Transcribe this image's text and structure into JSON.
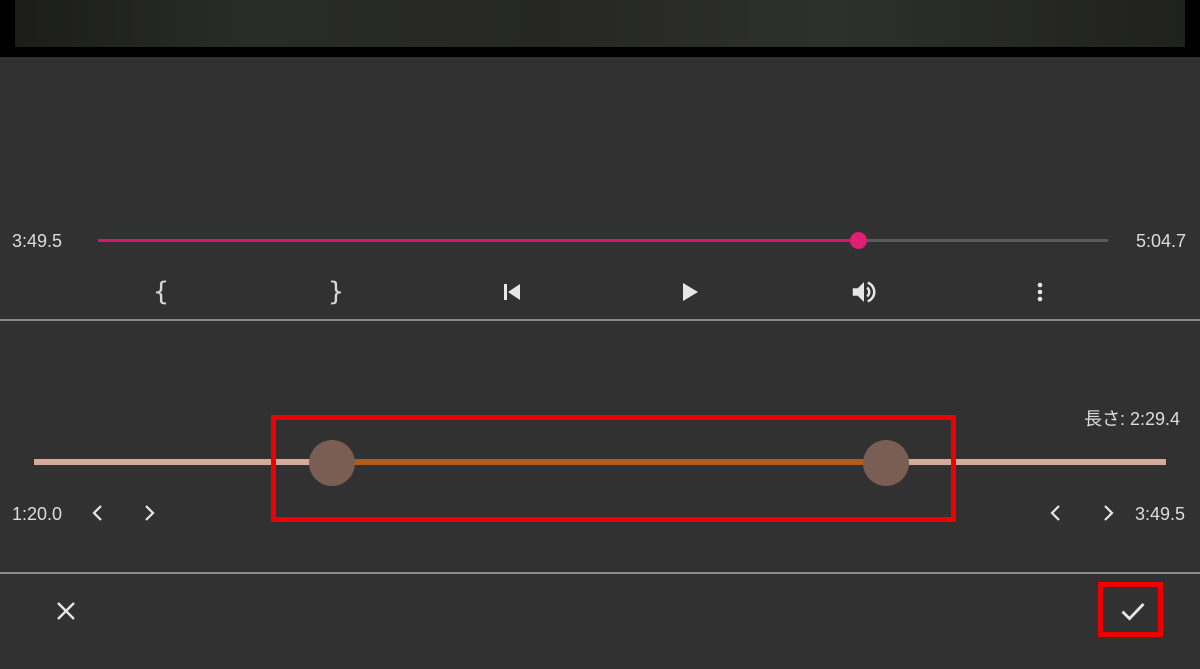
{
  "video": {
    "description_icon": "video-frame"
  },
  "player": {
    "current_time": "3:49.5",
    "total_time": "5:04.7",
    "progress_fraction": 0.752,
    "accent_color": "#d3196c",
    "controls": {
      "mark_in_label": "{",
      "mark_out_label": "}",
      "skip_previous_icon": "skip-previous-icon",
      "play_icon": "play-icon",
      "volume_icon": "volume-icon",
      "more_icon": "more-vert-icon"
    }
  },
  "trim": {
    "length_label": "長さ: 2:29.4",
    "start_time": "1:20.0",
    "end_time": "3:49.5",
    "start_fraction": 0.263,
    "end_fraction": 0.753,
    "track_color": "#d6aa98",
    "selection_color": "#b35b1a",
    "handle_color": "#7a5e54"
  },
  "actions": {
    "cancel_icon": "close-icon",
    "confirm_icon": "check-icon",
    "highlight_color": "#ee0000"
  }
}
